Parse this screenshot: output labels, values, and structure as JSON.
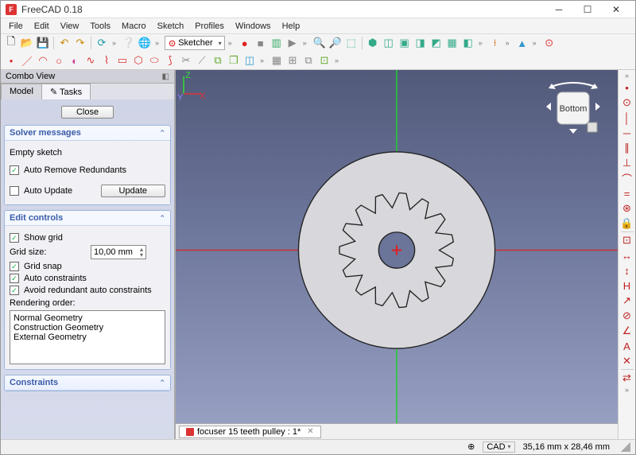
{
  "window": {
    "title": "FreeCAD 0.18"
  },
  "menu": [
    "File",
    "Edit",
    "View",
    "Tools",
    "Macro",
    "Sketch",
    "Profiles",
    "Windows",
    "Help"
  ],
  "workbench": {
    "selected": "Sketcher"
  },
  "combo": {
    "title": "Combo View",
    "tabs": {
      "model": "Model",
      "tasks": "Tasks"
    },
    "close": "Close"
  },
  "solver": {
    "header": "Solver messages",
    "status": "Empty sketch",
    "auto_remove": "Auto Remove Redundants",
    "auto_update": "Auto Update",
    "update_btn": "Update"
  },
  "edit": {
    "header": "Edit controls",
    "show_grid": "Show grid",
    "grid_size_label": "Grid size:",
    "grid_size_value": "10,00 mm",
    "grid_snap": "Grid snap",
    "auto_constraints": "Auto constraints",
    "avoid_redundant": "Avoid redundant auto constraints",
    "render_label": "Rendering order:",
    "render_items": [
      "Normal Geometry",
      "Construction Geometry",
      "External Geometry"
    ]
  },
  "constraints": {
    "header": "Constraints"
  },
  "viewcube": {
    "face": "Bottom"
  },
  "document": {
    "tab": "focuser 15 teeth pulley : 1*"
  },
  "status": {
    "cad": "CAD",
    "coords": "35,16 mm x 28,46 mm"
  },
  "axis": {
    "z": "Z",
    "x": "X",
    "y": "Y"
  }
}
